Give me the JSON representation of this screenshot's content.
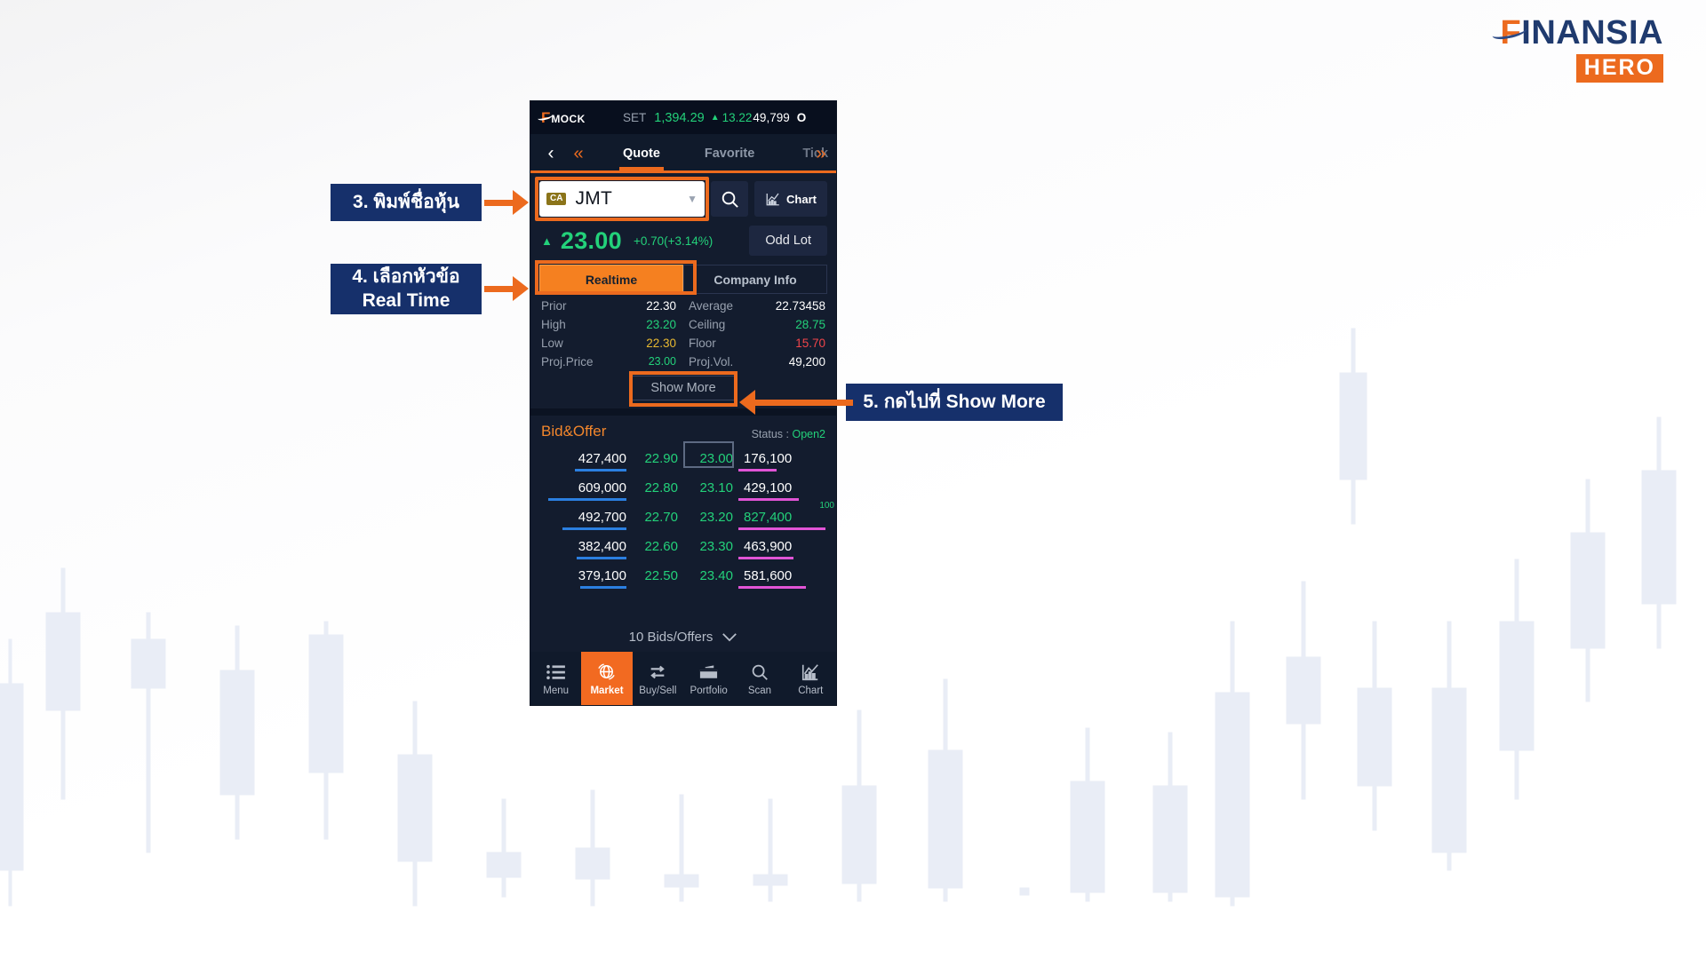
{
  "logo": {
    "brand": "INANSIA",
    "brand_initial": "F",
    "sub": "HERO",
    "navy": "#1f3a6e",
    "orange": "#ec6a1e"
  },
  "phone": {
    "market_header": {
      "brand_initial": "F",
      "brand_name": "MOCK",
      "index_label": "SET",
      "index_value": "1,394.29",
      "index_arrow": "▲",
      "index_change": "13.22",
      "volume": "49,799",
      "status_letter": "O"
    },
    "navbar": {
      "back_icon": "‹",
      "prev_icon": "«",
      "next_icon": "»",
      "tabs": [
        {
          "label": "Quote",
          "active": true
        },
        {
          "label": "Favorite",
          "active": false
        },
        {
          "label": "Tick",
          "active": false
        }
      ]
    },
    "symbol": {
      "badge": "CA",
      "value": "JMT",
      "caret": "▼",
      "search_icon": "search-icon",
      "chart_button": "Chart"
    },
    "quote": {
      "arrow": "▲",
      "price": "23.00",
      "change": "+0.70(+3.14%)",
      "odd_lot": "Odd Lot"
    },
    "info_tabs": [
      {
        "label": "Realtime",
        "active": true
      },
      {
        "label": "Company Info",
        "active": false
      }
    ],
    "stats": [
      {
        "k": "Prior",
        "v": "22.30",
        "v_color": "white",
        "k2": "Average",
        "v2": "22.73458",
        "v2_color": "white"
      },
      {
        "k": "High",
        "v": "23.20",
        "v_color": "green",
        "k2": "Ceiling",
        "v2": "28.75",
        "v2_color": "green"
      },
      {
        "k": "Low",
        "v": "22.30",
        "v_color": "yellow",
        "k2": "Floor",
        "v2": "15.70",
        "v2_color": "red"
      },
      {
        "k": "Proj.Price",
        "v": "23.00",
        "v_color": "green",
        "k2": "Proj.Vol.",
        "v2": "49,200",
        "v2_color": "white"
      }
    ],
    "show_more": "Show More",
    "bid_offer": {
      "title": "Bid&Offer",
      "status_label": "Status :",
      "status_value": "Open2",
      "side_label": "100",
      "rows": [
        {
          "bid_vol": "427,400",
          "bid_px": "22.90",
          "off_px": "23.00",
          "off_vol": "176,100",
          "off_vol_color": "white",
          "bid_bar": 58,
          "off_bar": 43,
          "boxed": true
        },
        {
          "bid_vol": "609,000",
          "bid_px": "22.80",
          "off_px": "23.10",
          "off_vol": "429,100",
          "off_vol_color": "white",
          "bid_bar": 96,
          "off_bar": 68,
          "boxed": false
        },
        {
          "bid_vol": "492,700",
          "bid_px": "22.70",
          "off_px": "23.20",
          "off_vol": "827,400",
          "off_vol_color": "green",
          "bid_bar": 78,
          "off_bar": 100,
          "boxed": false
        },
        {
          "bid_vol": "382,400",
          "bid_px": "22.60",
          "off_px": "23.30",
          "off_vol": "463,900",
          "off_vol_color": "white",
          "bid_bar": 70,
          "off_bar": 72,
          "boxed": false
        },
        {
          "bid_vol": "379,100",
          "bid_px": "22.50",
          "off_px": "23.40",
          "off_vol": "581,600",
          "off_vol_color": "white",
          "bid_bar": 62,
          "off_bar": 83,
          "boxed": false
        }
      ]
    },
    "bids_offers_toggle": {
      "label": "10 Bids/Offers",
      "caret": "⌄"
    },
    "bottom_nav": [
      {
        "label": "Menu",
        "icon": "list-icon",
        "active": false
      },
      {
        "label": "Market",
        "icon": "globe-icon",
        "active": true
      },
      {
        "label": "Buy/Sell",
        "icon": "exchange-icon",
        "active": false
      },
      {
        "label": "Portfolio",
        "icon": "briefcase-icon",
        "active": false
      },
      {
        "label": "Scan",
        "icon": "search-icon",
        "active": false
      },
      {
        "label": "Chart",
        "icon": "chart-icon",
        "active": false
      }
    ]
  },
  "callouts": [
    {
      "id": "c3",
      "line1": "3. พิมพ์ชื่อหุ้น",
      "line2": ""
    },
    {
      "id": "c4",
      "line1": "4. เลือกหัวข้อ",
      "line2": "Real Time"
    },
    {
      "id": "c5",
      "line1": "5. กดไปที่ Show More",
      "line2": ""
    }
  ]
}
